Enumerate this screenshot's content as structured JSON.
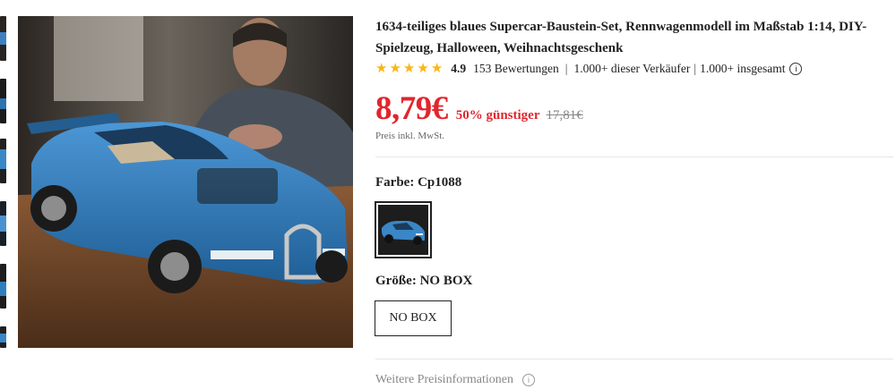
{
  "product": {
    "title": "1634-teiliges blaues Supercar-Baustein-Set, Rennwagenmodell im Maßstab 1:14, DIY-Spielzeug, Halloween, Weihnachtsgeschenk",
    "rating": "4.9",
    "rating_stars": 5,
    "reviews": "153 Bewertungen",
    "seller_sold": "1.000+ dieser Verkäufer",
    "total_sold": "1.000+ insgesamt",
    "price": "8,79€",
    "discount": "50% günstiger",
    "old_price": "17,81€",
    "tax_note": "Preis inkl. MwSt.",
    "color_label": "Farbe: Cp1088",
    "size_label": "Größe: NO BOX",
    "size_option": "NO BOX",
    "more_info": "Weitere Preisinformationen"
  },
  "icons": {
    "star": "star-icon",
    "info": "info-icon"
  },
  "colors": {
    "accent_red": "#e1262d",
    "star_yellow": "#fbb612",
    "car_blue": "#2f7fbf"
  }
}
